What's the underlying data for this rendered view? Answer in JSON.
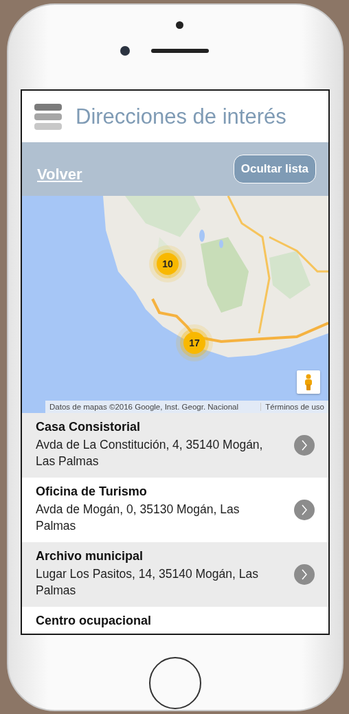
{
  "header": {
    "title": "Direcciones de interés"
  },
  "toolbar": {
    "back_link": "Volver",
    "toggle_button": "Ocultar lista"
  },
  "map": {
    "clusters": [
      {
        "count": "10"
      },
      {
        "count": "17"
      }
    ],
    "attribution": "Datos de mapas ©2016 Google, Inst. Geogr. Nacional",
    "terms_link": "Términos de uso"
  },
  "places": [
    {
      "name": "Casa Consistorial",
      "address": "Avda de La Constitución, 4, 35140 Mogán, Las Palmas"
    },
    {
      "name": "Oficina de Turismo",
      "address": "Avda de Mogán, 0, 35130 Mogán, Las Palmas"
    },
    {
      "name": "Archivo municipal",
      "address": "Lugar Los Pasitos, 14, 35140 Mogán, Las Palmas"
    },
    {
      "name": "Centro ocupacional"
    }
  ]
}
